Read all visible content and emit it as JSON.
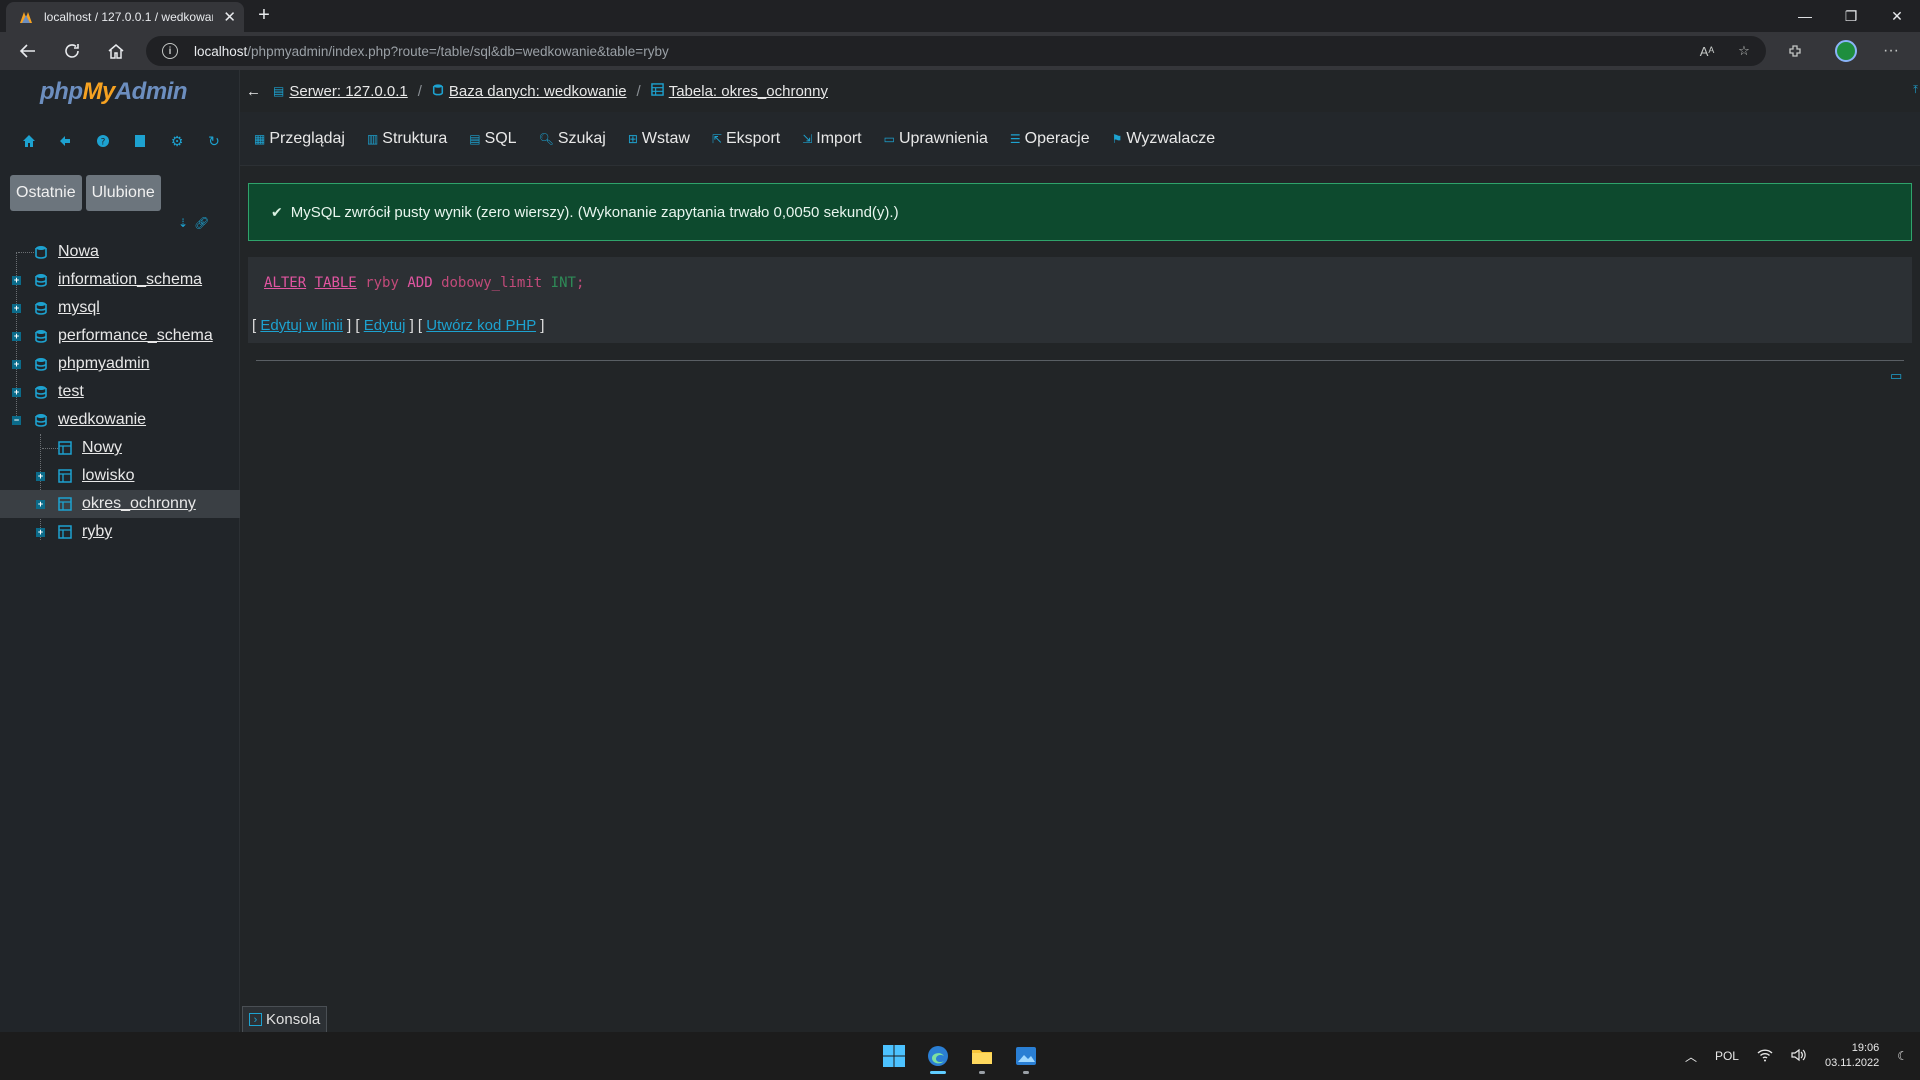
{
  "browser": {
    "tab_title": "localhost / 127.0.0.1 / wedkowan",
    "url_host": "localhost",
    "url_path": "/phpmyadmin/index.php?route=/table/sql&db=wedkowanie&table=ryby"
  },
  "sidebar": {
    "logo_php": "php",
    "logo_my": "My",
    "logo_admin": "Admin",
    "tabs": [
      "Ostatnie",
      "Ulubione"
    ],
    "tree": [
      {
        "label": "Nowa"
      },
      {
        "label": "information_schema"
      },
      {
        "label": "mysql"
      },
      {
        "label": "performance_schema"
      },
      {
        "label": "phpmyadmin"
      },
      {
        "label": "test"
      },
      {
        "label": "wedkowanie"
      },
      {
        "label": "Nowy"
      },
      {
        "label": "lowisko"
      },
      {
        "label": "okres_ochronny"
      },
      {
        "label": "ryby"
      }
    ]
  },
  "breadcrumb": {
    "server": "Serwer: 127.0.0.1",
    "database": "Baza danych: wedkowanie",
    "table": "Tabela: okres_ochronny"
  },
  "menu": [
    "Przeglądaj",
    "Struktura",
    "SQL",
    "Szukaj",
    "Wstaw",
    "Eksport",
    "Import",
    "Uprawnienia",
    "Operacje",
    "Wyzwalacze"
  ],
  "message": "MySQL zwrócił pusty wynik (zero wierszy). (Wykonanie zapytania trwało 0,0050 sekund(y).)",
  "sql": {
    "alter": "ALTER",
    "table": "TABLE",
    "name": "ryby",
    "add": "ADD",
    "column": "dobowy_limit",
    "type": "INT",
    "end": ";"
  },
  "sql_links": {
    "inline_edit": "Edytuj w linii",
    "edit": "Edytuj",
    "php": "Utwórz kod PHP"
  },
  "console": "Konsola",
  "taskbar": {
    "lang": "POL",
    "time": "19:06",
    "date": "03.11.2022"
  },
  "colors": {
    "accent": "#1da2d0",
    "success_bg": "#0d4a2e",
    "keyword": "#e255a1"
  }
}
